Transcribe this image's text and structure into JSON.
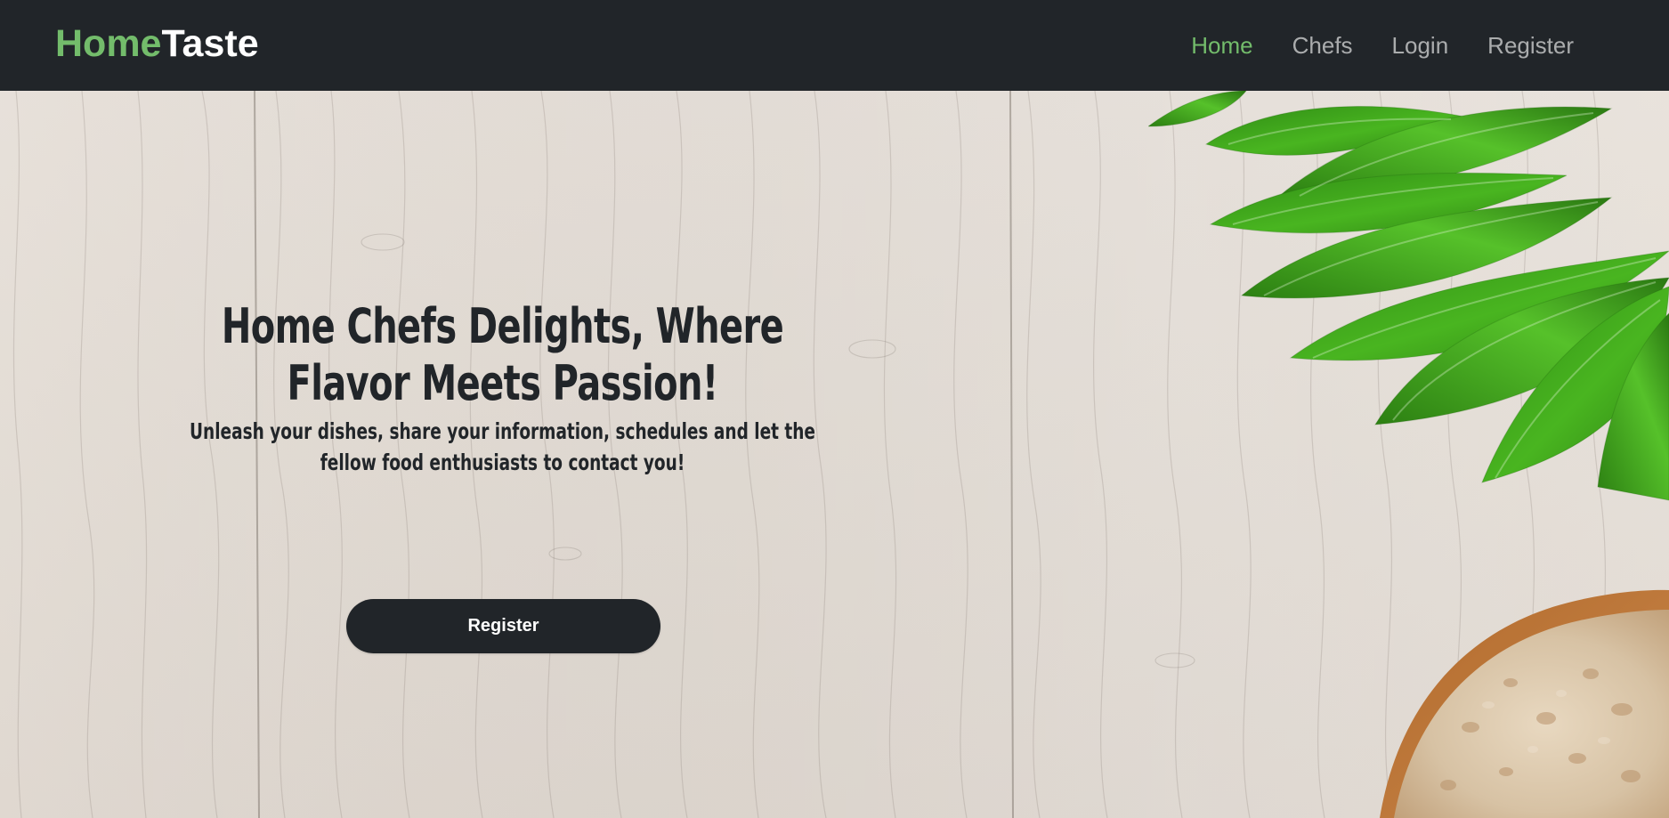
{
  "navbar": {
    "brand": {
      "part1": "Home",
      "part2": "Taste"
    },
    "links": [
      {
        "label": "Home",
        "active": true
      },
      {
        "label": "Chefs",
        "active": false
      },
      {
        "label": "Login",
        "active": false
      },
      {
        "label": "Register",
        "active": false
      }
    ]
  },
  "hero": {
    "title": "Home Chefs Delights, Where Flavor Meets Passion!",
    "subtitle": "Unleash your dishes, share your information, schedules and let the fellow food enthusiasts to contact you!",
    "button_label": "Register"
  },
  "colors": {
    "navbar_bg": "#212529",
    "brand_accent": "#73bc6b",
    "button_bg": "#212529",
    "text_dark": "#212529"
  },
  "icons": {
    "leaves": "green-leaves-image",
    "bread": "bread-slice-image"
  }
}
